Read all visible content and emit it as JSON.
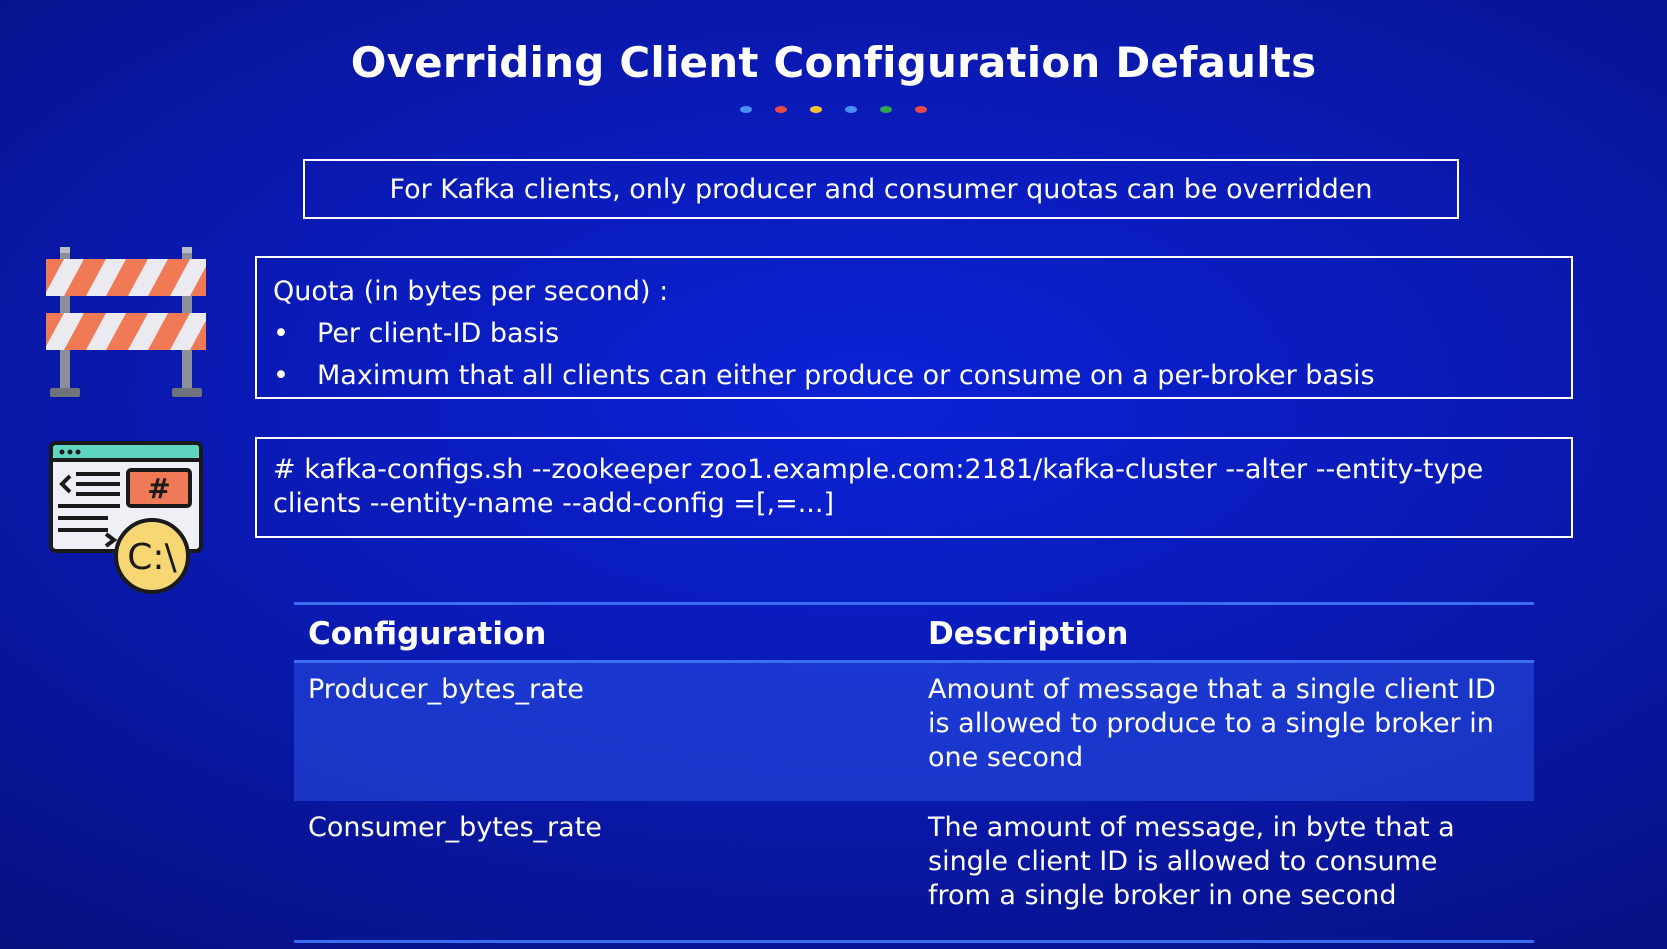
{
  "title": "Overriding Client Configuration Defaults",
  "dots": [
    "#4a8df5",
    "#e84a4a",
    "#f5c531",
    "#4a8df5",
    "#2ea84f",
    "#e84a4a"
  ],
  "note": "For Kafka clients, only producer and consumer quotas can be overridden",
  "quota": {
    "heading": "Quota (in bytes per second) :",
    "bullet_symbol": "•",
    "items": [
      "Per client-ID basis",
      "Maximum that all clients can either produce or consume on a per-broker basis"
    ]
  },
  "command": {
    "line1": "# kafka-configs.sh --zookeeper zoo1.example.com:2181/kafka-cluster --alter --entity-type",
    "line2": "clients --entity-name --add-config =[,=...]"
  },
  "icons": {
    "barrier": "road-barrier-icon",
    "terminal": "command-line-icon",
    "terminal_label": "C:\\",
    "terminal_hash": "#"
  },
  "table": {
    "headers": [
      "Configuration",
      "Description"
    ],
    "rows": [
      {
        "config": "Producer_bytes_rate",
        "description_lines": [
          "Amount of message that a single client ID",
          "is allowed to produce to a single broker in",
          "one second"
        ]
      },
      {
        "config": "Consumer_bytes_rate",
        "description_lines": [
          "The amount of message, in byte that a",
          "single client ID is allowed to consume",
          "from a single broker in one second"
        ]
      }
    ]
  },
  "colors": {
    "background": "#0a1ab4",
    "table_rule": "#3b6df0",
    "barrier_stripe": "#f07a55",
    "icon_teal": "#5fd6c2",
    "icon_yellow": "#f7d774"
  }
}
